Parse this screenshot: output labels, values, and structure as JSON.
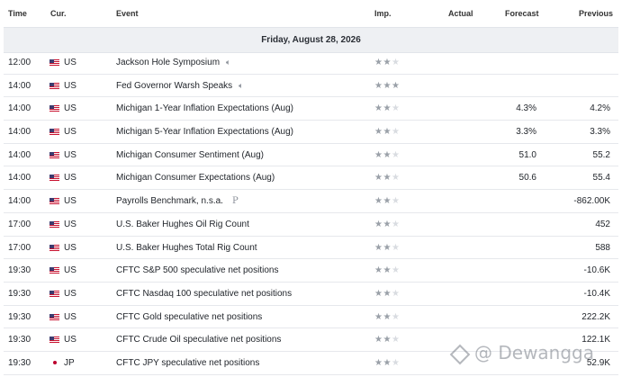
{
  "header": {
    "time": "Time",
    "currency": "Cur.",
    "event": "Event",
    "importance": "Imp.",
    "actual": "Actual",
    "forecast": "Forecast",
    "previous": "Previous"
  },
  "date_label": "Friday, August 28, 2026",
  "rows": [
    {
      "time": "12:00",
      "flag": "us",
      "cur": "US",
      "event": "Jackson Hole Symposium",
      "icon": "speaker",
      "stars": 2,
      "forecast": "",
      "previous": ""
    },
    {
      "time": "14:00",
      "flag": "us",
      "cur": "US",
      "event": "Fed Governor Warsh Speaks",
      "icon": "speaker",
      "stars": 3,
      "forecast": "",
      "previous": ""
    },
    {
      "time": "14:00",
      "flag": "us",
      "cur": "US",
      "event": "Michigan 1-Year Inflation Expectations  (Aug)",
      "icon": "",
      "stars": 2,
      "forecast": "4.3%",
      "previous": "4.2%"
    },
    {
      "time": "14:00",
      "flag": "us",
      "cur": "US",
      "event": "Michigan 5-Year Inflation Expectations  (Aug)",
      "icon": "",
      "stars": 2,
      "forecast": "3.3%",
      "previous": "3.3%"
    },
    {
      "time": "14:00",
      "flag": "us",
      "cur": "US",
      "event": "Michigan Consumer Sentiment  (Aug)",
      "icon": "",
      "stars": 2,
      "forecast": "51.0",
      "previous": "55.2"
    },
    {
      "time": "14:00",
      "flag": "us",
      "cur": "US",
      "event": "Michigan Consumer Expectations  (Aug)",
      "icon": "",
      "stars": 2,
      "forecast": "50.6",
      "previous": "55.4"
    },
    {
      "time": "14:00",
      "flag": "us",
      "cur": "US",
      "event": "Payrolls Benchmark, n.s.a.",
      "icon": "preliminary",
      "stars": 2,
      "forecast": "",
      "previous": "-862.00K"
    },
    {
      "time": "17:00",
      "flag": "us",
      "cur": "US",
      "event": "U.S. Baker Hughes Oil Rig Count",
      "icon": "",
      "stars": 2,
      "forecast": "",
      "previous": "452"
    },
    {
      "time": "17:00",
      "flag": "us",
      "cur": "US",
      "event": "U.S. Baker Hughes Total Rig Count",
      "icon": "",
      "stars": 2,
      "forecast": "",
      "previous": "588"
    },
    {
      "time": "19:30",
      "flag": "us",
      "cur": "US",
      "event": "CFTC S&P 500 speculative net positions",
      "icon": "",
      "stars": 2,
      "forecast": "",
      "previous": "-10.6K"
    },
    {
      "time": "19:30",
      "flag": "us",
      "cur": "US",
      "event": "CFTC Nasdaq 100 speculative net positions",
      "icon": "",
      "stars": 2,
      "forecast": "",
      "previous": "-10.4K"
    },
    {
      "time": "19:30",
      "flag": "us",
      "cur": "US",
      "event": "CFTC Gold speculative net positions",
      "icon": "",
      "stars": 2,
      "forecast": "",
      "previous": "222.2K"
    },
    {
      "time": "19:30",
      "flag": "us",
      "cur": "US",
      "event": "CFTC Crude Oil speculative net positions",
      "icon": "",
      "stars": 2,
      "forecast": "",
      "previous": "122.1K"
    },
    {
      "time": "19:30",
      "flag": "jp",
      "cur": "JP",
      "event": "CFTC JPY speculative net positions",
      "icon": "",
      "stars": 2,
      "forecast": "",
      "previous": "52.9K"
    }
  ],
  "icons": {
    "speaker": "speaker-icon",
    "preliminary": "preliminary-icon",
    "star": "star-icon"
  },
  "watermark": "@ Dewangga",
  "colors": {
    "date_bg": "#eef0f3",
    "star_on": "#9aa0a8",
    "star_off": "#d9dce1",
    "flag_red": "#c8102e",
    "flag_blue": "#3c3b6e"
  }
}
